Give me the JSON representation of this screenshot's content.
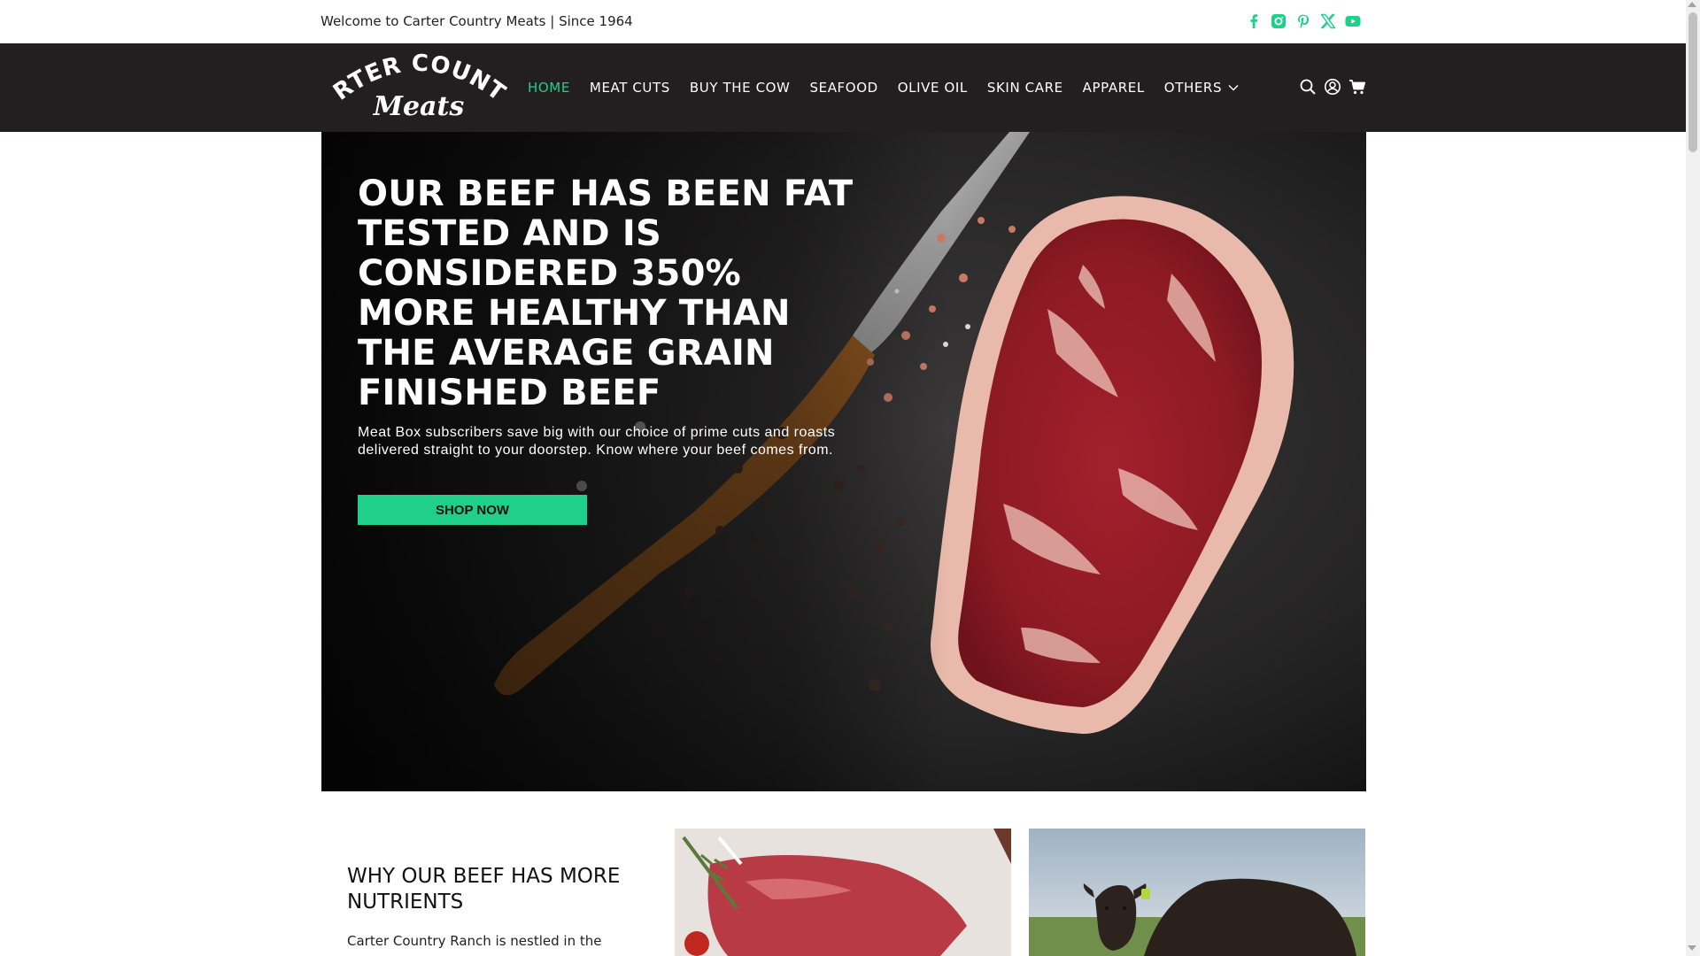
{
  "topbar": {
    "welcome": "Welcome to Carter Country Meats | Since 1964",
    "social_icons": [
      "facebook-icon",
      "instagram-icon",
      "pinterest-icon",
      "x-twitter-icon",
      "youtube-icon"
    ]
  },
  "header": {
    "logo_text_top": "CARTER COUNTRY",
    "logo_text_bottom": "Meats",
    "nav": [
      {
        "label": "HOME",
        "active": true
      },
      {
        "label": "MEAT CUTS"
      },
      {
        "label": "BUY THE COW"
      },
      {
        "label": "SEAFOOD"
      },
      {
        "label": "OLIVE OIL"
      },
      {
        "label": "SKIN CARE"
      },
      {
        "label": "APPAREL"
      },
      {
        "label": "OTHERS"
      }
    ],
    "icons": [
      "search-icon",
      "account-icon",
      "cart-icon"
    ]
  },
  "hero": {
    "title": "OUR BEEF HAS BEEN FAT TESTED AND IS CONSIDERED 350% MORE HEALTHY THAN THE AVERAGE GRAIN FINISHED BEEF",
    "text": "Meat Box subscribers save big with our choice of prime cuts and roasts delivered straight to your doorstep. Know where your beef comes from.",
    "button": "SHOP NOW"
  },
  "section": {
    "title": "WHY OUR BEEF HAS MORE NUTRIENTS",
    "text": "Carter Country Ranch is nestled in the"
  },
  "colors": {
    "accent": "#1fcf8a",
    "header_bg": "#231f20"
  }
}
